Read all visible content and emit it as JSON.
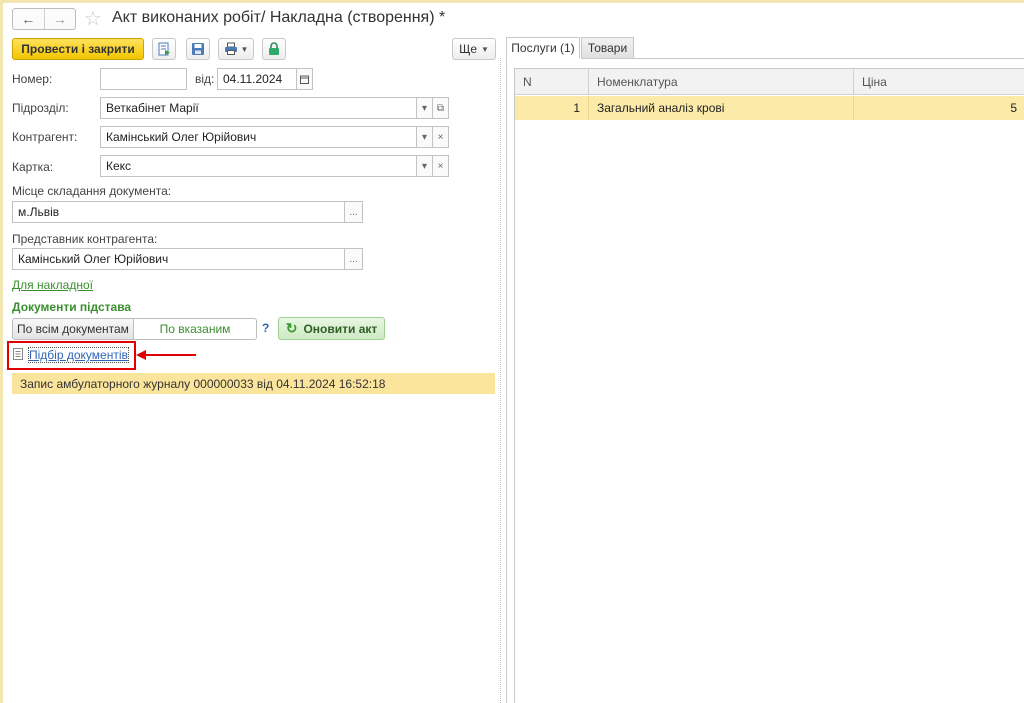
{
  "window": {
    "title": "Акт виконаних робіт/ Накладна (створення) *"
  },
  "toolbar": {
    "post_close_label": "Провести і закрити",
    "more_label": "Ще"
  },
  "form": {
    "number_label": "Номер:",
    "number_value": "",
    "date_from_label": "від:",
    "date_value": "04.11.2024",
    "division_label": "Підрозділ:",
    "division_value": "Веткабінет Марії",
    "counterparty_label": "Контрагент:",
    "counterparty_value": "Камінський Олег Юрійович",
    "card_label": "Картка:",
    "card_value": "Кекс",
    "place_label": "Місце складання документа:",
    "place_value": "м.Львів",
    "representative_label": "Представник контрагента:",
    "representative_value": "Камінський Олег Юрійович",
    "invoice_link": "Для накладної"
  },
  "base_docs": {
    "section_title": "Документи підстава",
    "all_docs": "По всім документам",
    "specified": "По вказаним",
    "help": "?",
    "refresh": "Оновити акт",
    "pick_link": "Підбір документів",
    "doc_entry": "Запис амбулаторного журналу 000000033 від 04.11.2024 16:52:18"
  },
  "tabs": [
    {
      "label": "Послуги (1)",
      "active": true
    },
    {
      "label": "Товари",
      "active": false
    }
  ],
  "services_table": {
    "columns": [
      "N",
      "Номенклатура",
      "Ціна"
    ],
    "rows": [
      {
        "n": "1",
        "name": "Загальний аналіз крові",
        "price": "5"
      }
    ]
  },
  "colors": {
    "primary_button": "#f2c500",
    "highlight_row": "#fbeaa8",
    "section_green": "#3b8e2f",
    "annotation_red": "#e00000"
  }
}
